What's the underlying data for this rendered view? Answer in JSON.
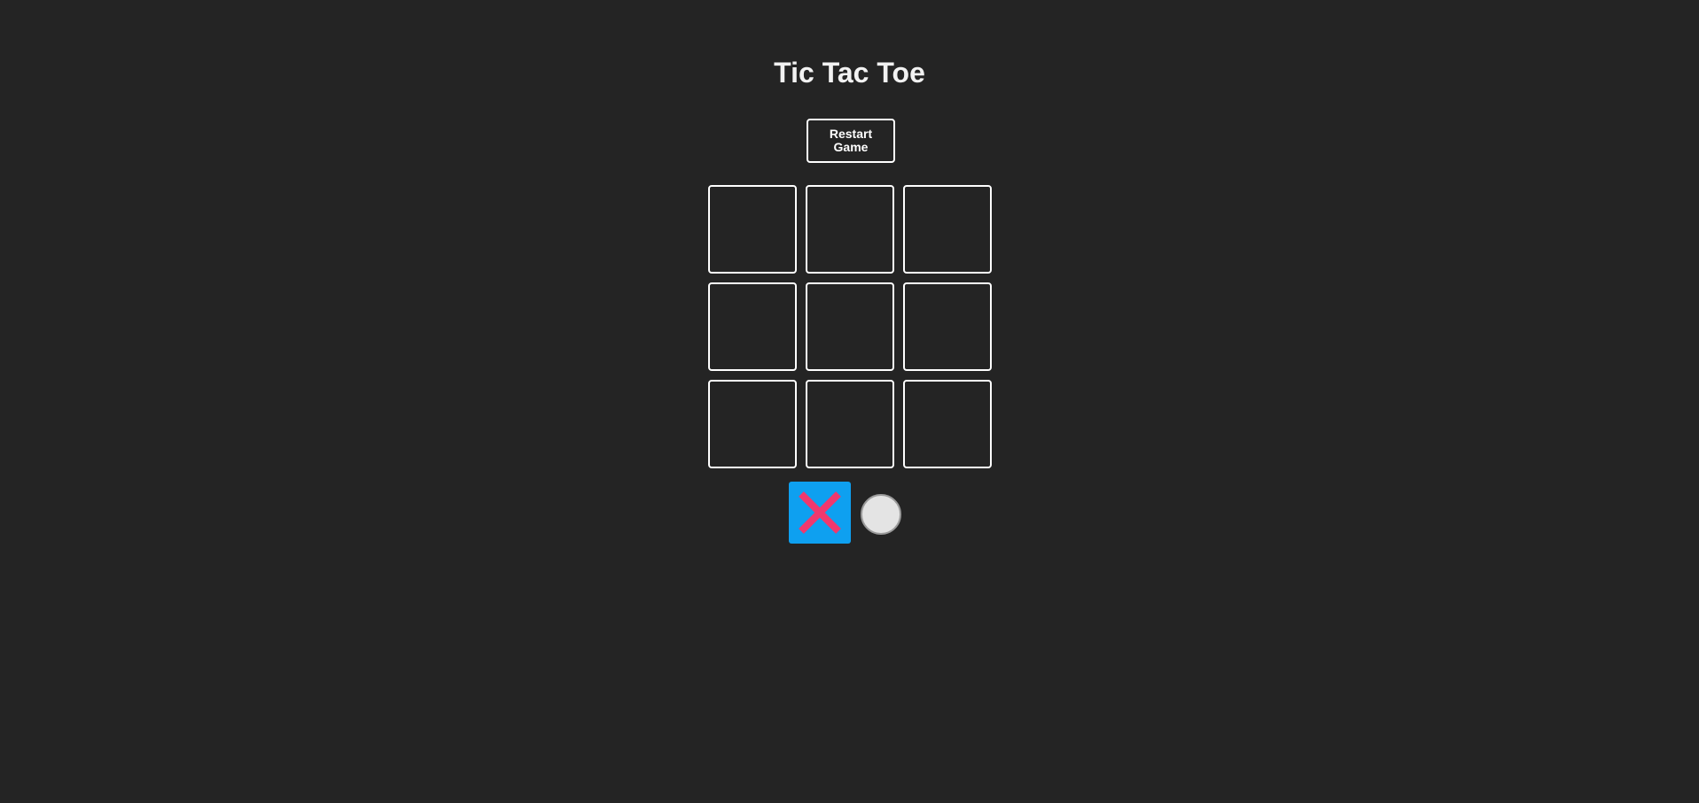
{
  "header": {
    "title": "Tic Tac Toe"
  },
  "controls": {
    "restart_label": "Restart Game"
  },
  "board": {
    "cells": [
      "",
      "",
      "",
      "",
      "",
      "",
      "",
      "",
      ""
    ]
  },
  "players": [
    {
      "symbol_icon": "x-icon",
      "selected": true,
      "background_color": "#0ea0f0",
      "symbol_color": "#f0386e"
    },
    {
      "symbol_icon": "circle-icon",
      "selected": false,
      "background_color": "#e4e4e4",
      "border_color": "#9a9a9a"
    }
  ],
  "colors": {
    "page_background": "#242424",
    "board_border": "#ffffff"
  }
}
